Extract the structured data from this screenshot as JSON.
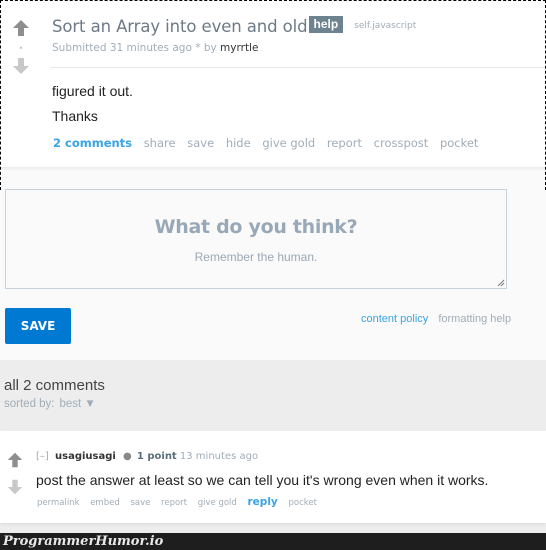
{
  "post": {
    "title": "Sort an Array into even and old",
    "flair": "help",
    "domain": "self.javascript",
    "submitted_prefix": "Submitted 31 minutes ago * by",
    "author": "myrrtle",
    "score": "•",
    "body": [
      "figured it out.",
      "Thanks"
    ],
    "actions": {
      "comments": "2 comments",
      "share": "share",
      "save": "save",
      "hide": "hide",
      "give_gold": "give gold",
      "report": "report",
      "crosspost": "crosspost",
      "pocket": "pocket"
    }
  },
  "comment_box": {
    "placeholder_title": "What do you think?",
    "placeholder_sub": "Remember the human.",
    "save_label": "SAVE",
    "content_policy": "content policy",
    "formatting_help": "formatting help"
  },
  "comments_header": {
    "title": "all 2 comments",
    "sorted_label": "sorted by:",
    "sorted_value": "best ▼"
  },
  "comments": [
    {
      "collapse": "[–]",
      "author": "usagiusagi",
      "bullet": "●",
      "score": "1 point",
      "time": "13 minutes ago",
      "body": "post the answer at least so we can tell you it's wrong even when it works.",
      "actions": {
        "permalink": "permalink",
        "embed": "embed",
        "save": "save",
        "report": "report",
        "give_gold": "give gold",
        "reply": "reply",
        "pocket": "pocket"
      }
    }
  ],
  "watermark": "ProgrammerHumor.io",
  "colors": {
    "accent_blue": "#0079d3",
    "link_blue": "#3aa3e3",
    "muted": "#a0adb8",
    "flair_bg": "#6e8390"
  }
}
